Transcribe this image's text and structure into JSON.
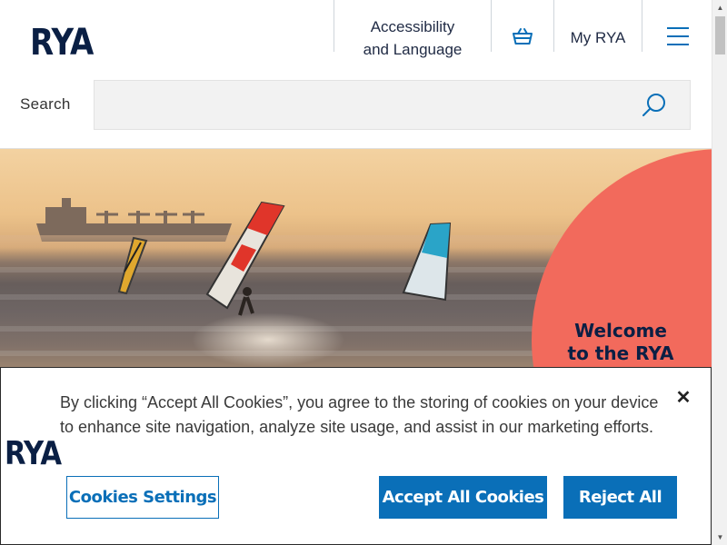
{
  "header": {
    "logo": "RYA",
    "accessibility_line1": "Accessibility",
    "accessibility_line2": "and Language",
    "basket_icon": "basket-icon",
    "my_rya": "My RYA",
    "menu_icon": "hamburger-menu-icon"
  },
  "search": {
    "label": "Search",
    "placeholder": "",
    "icon": "search-icon"
  },
  "hero": {
    "welcome_line1": "Welcome",
    "welcome_line2": "to the RYA",
    "accent_color": "#f26a5c"
  },
  "cookie_banner": {
    "logo": "RYA",
    "text": "By clicking “Accept All Cookies”, you agree to the storing of cookies on your device to enhance site navigation, analyze site usage, and assist in our marketing efforts.",
    "close_icon": "close-icon",
    "settings_label": "Cookies Settings",
    "accept_label": "Accept All Cookies",
    "reject_label": "Reject All",
    "button_color": "#0a6fb8"
  }
}
